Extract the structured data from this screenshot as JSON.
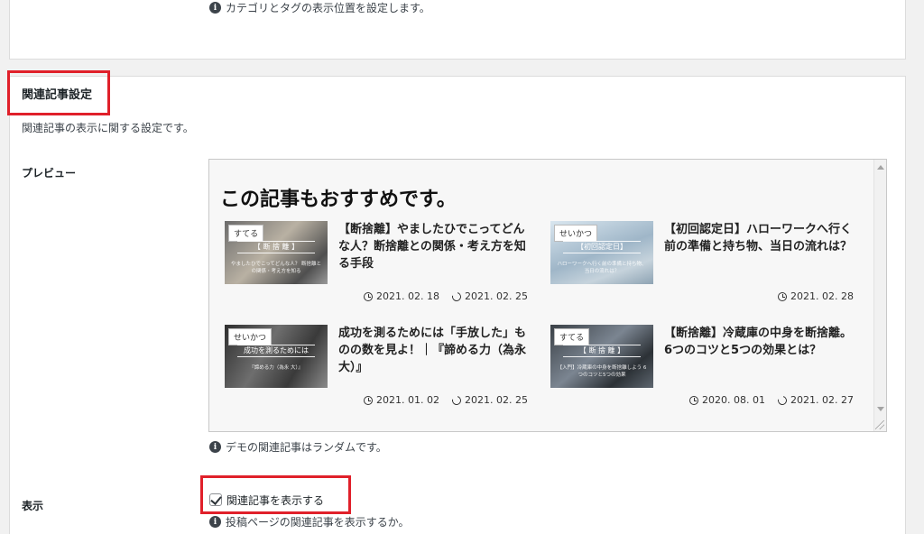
{
  "notes": {
    "category_tag_position": "カテゴリとタグの表示位置を設定します。",
    "demo_random": "デモの関連記事はランダムです。",
    "show_on_post": "投稿ページの関連記事を表示するか。"
  },
  "section": {
    "title": "関連記事設定",
    "description": "関連記事の表示に関する設定です。"
  },
  "labels": {
    "preview": "プレビュー",
    "display": "表示"
  },
  "preview": {
    "heading": "この記事もおすすめです。",
    "cards": [
      {
        "category": "すてる",
        "thumb_band": "【 断 捨 離 】",
        "thumb_sub": "やましたひでこってどんな人？ 断捨離との関係・考え方を知る",
        "title": "【断捨離】やましたひでこってどんな人？断捨離との関係・考え方を知る手段",
        "published": "2021. 02. 18",
        "updated": "2021. 02. 25"
      },
      {
        "category": "せいかつ",
        "thumb_band": "【初回認定日】",
        "thumb_sub": "ハローワークへ行く前の準備と持ち物、当日の流れは？",
        "title": "【初回認定日】ハローワークへ行く前の準備と持ち物、当日の流れは？",
        "published": "2021. 02. 28",
        "updated": ""
      },
      {
        "category": "せいかつ",
        "thumb_band": "成功を測るためには",
        "thumb_sub": "『諦める力（為永 大）』",
        "title": "成功を測るためには「手放した」ものの数を見よ！｜『諦める力（為永 大）』",
        "published": "2021. 01. 02",
        "updated": "2021. 02. 25"
      },
      {
        "category": "すてる",
        "thumb_band": "【 断 捨 離 】",
        "thumb_sub": "【入門】冷蔵庫の中身を断捨離しよう 6つのコツと5つの効果",
        "title": "【断捨離】冷蔵庫の中身を断捨離。6つのコツと5つの効果とは？",
        "published": "2020. 08. 01",
        "updated": "2021. 02. 27"
      }
    ]
  },
  "display_option": {
    "label": "関連記事を表示する",
    "checked": true
  },
  "colors": {
    "highlight": "#e0202a"
  },
  "icons": {
    "info": "info-circle-icon",
    "published": "clock-icon",
    "updated": "update-icon"
  }
}
